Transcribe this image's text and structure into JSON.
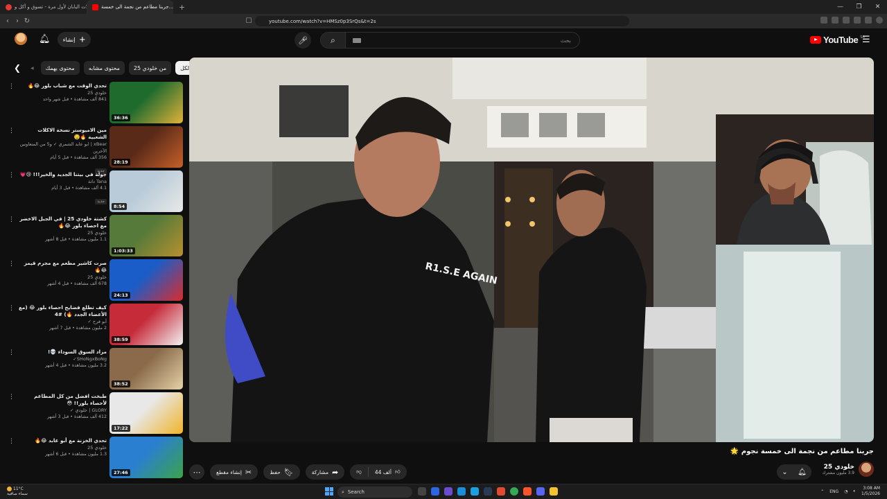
{
  "browser": {
    "tabs": [
      {
        "title": "وصلات اليابان لأول مرة - تسوق و أكل و..."
      },
      {
        "title": "جربنا مطاعم من نجمة الى خمسة..."
      }
    ],
    "url": "youtube.com/watch?v=HMSz0p3SrQs&t=2s"
  },
  "header": {
    "create_label": "إنشاء",
    "search_placeholder": "بحث",
    "logo_text": "YouTube",
    "country_code": "SA"
  },
  "chips": [
    "الكل",
    "من خلودي 25",
    "محتوى مشابه",
    "محتوى يهمك"
  ],
  "recommendations": [
    {
      "title": "تحدي الوقت مع شباب بلور 😂🔥",
      "channel": "خلودي 25",
      "stats": "841 ألف مشاهدة • قبل شهر واحد",
      "duration": "36:36",
      "badge": "",
      "colors": [
        "#1f6b2e",
        "#e2b23a"
      ]
    },
    {
      "title": "مين الاميوستر نسخة الاكلات الشعبية 🔥🤤",
      "channel": "xBear | ابو عابد الشمري ✓ و5 من المتعاونين الآخرين",
      "stats": "356 ألف مشاهدة • قبل 5 أيام",
      "duration": "28:19",
      "badge": "جديد",
      "colors": [
        "#5a2a18",
        "#c6602a"
      ]
    },
    {
      "title": "جولة في بيتنا الجديد والخير!!! 😢💗",
      "channel": "Tana دانة",
      "stats": "4.1 ألف مشاهدة • قبل 3 أيام",
      "duration": "8:54",
      "badge": "جديد",
      "colors": [
        "#b9cbd8",
        "#e8e8e8"
      ]
    },
    {
      "title": "كشتة خلودي 25 | في الجبل الاخضر مع احصاء بلور 😂🔥",
      "channel": "خلودي 25",
      "stats": "1.1 مليون مشاهدة • قبل 8 أشهر",
      "duration": "1:03:33",
      "badge": "",
      "colors": [
        "#567a3a",
        "#b8902f"
      ]
    },
    {
      "title": "صرت كاشير مطعم مع مجرم قيمز 😂🔥",
      "channel": "خلودي 25",
      "stats": "678 ألف مشاهدة • قبل 4 أشهر",
      "duration": "24:13",
      "badge": "",
      "colors": [
        "#1b5dc8",
        "#d92c2c"
      ]
    },
    {
      "title": "كيف تطلع فضايح احصاء بلور 😂 (مع الأعضاء الجدد 🔥) #4",
      "channel": "أبو فرح ✓",
      "stats": "2 مليون مشاهدة • قبل 7 أشهر",
      "duration": "38:59",
      "badge": "",
      "colors": [
        "#c62b3a",
        "#f2f2f2"
      ]
    },
    {
      "title": "مزاد السوق السوداء 💀!",
      "channel": "SHoNgxBoNg✓",
      "stats": "3.2 مليون مشاهدة • قبل 4 أشهر",
      "duration": "38:52",
      "badge": "",
      "colors": [
        "#8a6a4a",
        "#e5d2a8"
      ]
    },
    {
      "title": "طبخت افضل من كل المطاعم لأحصاء بلور!! 😳",
      "channel": "GLORY | خلودي ✓",
      "stats": "412 ألف مشاهدة • قبل 3 أشهر",
      "duration": "17:22",
      "badge": "",
      "colors": [
        "#e8e8e8",
        "#f0b429"
      ]
    },
    {
      "title": "تحدي الخزنة مع أبو عابد 😂🔥",
      "channel": "خلودي 25",
      "stats": "1.3 مليون مشاهدة • قبل 6 أشهر",
      "duration": "27:46",
      "badge": "",
      "colors": [
        "#2b7fd0",
        "#3aa34a"
      ]
    }
  ],
  "video": {
    "title": "جربنا مطاعم من نجمة الى خمسة نجوم 🌟",
    "channel": "خلودي 25",
    "subscribers": "3.9 مليون مشترك",
    "likes": "44 ألف",
    "share_label": "مشاركة",
    "save_label": "حفظ",
    "clip_label": "إنشاء مقطع",
    "shirt_text": "R1.S.E AGAIN"
  },
  "taskbar": {
    "temperature": "11°C",
    "weather_desc": "سماء صافية",
    "search_label": "Search",
    "lang": "ENG",
    "time": "3:08 AM",
    "date": "1/5/2026"
  }
}
